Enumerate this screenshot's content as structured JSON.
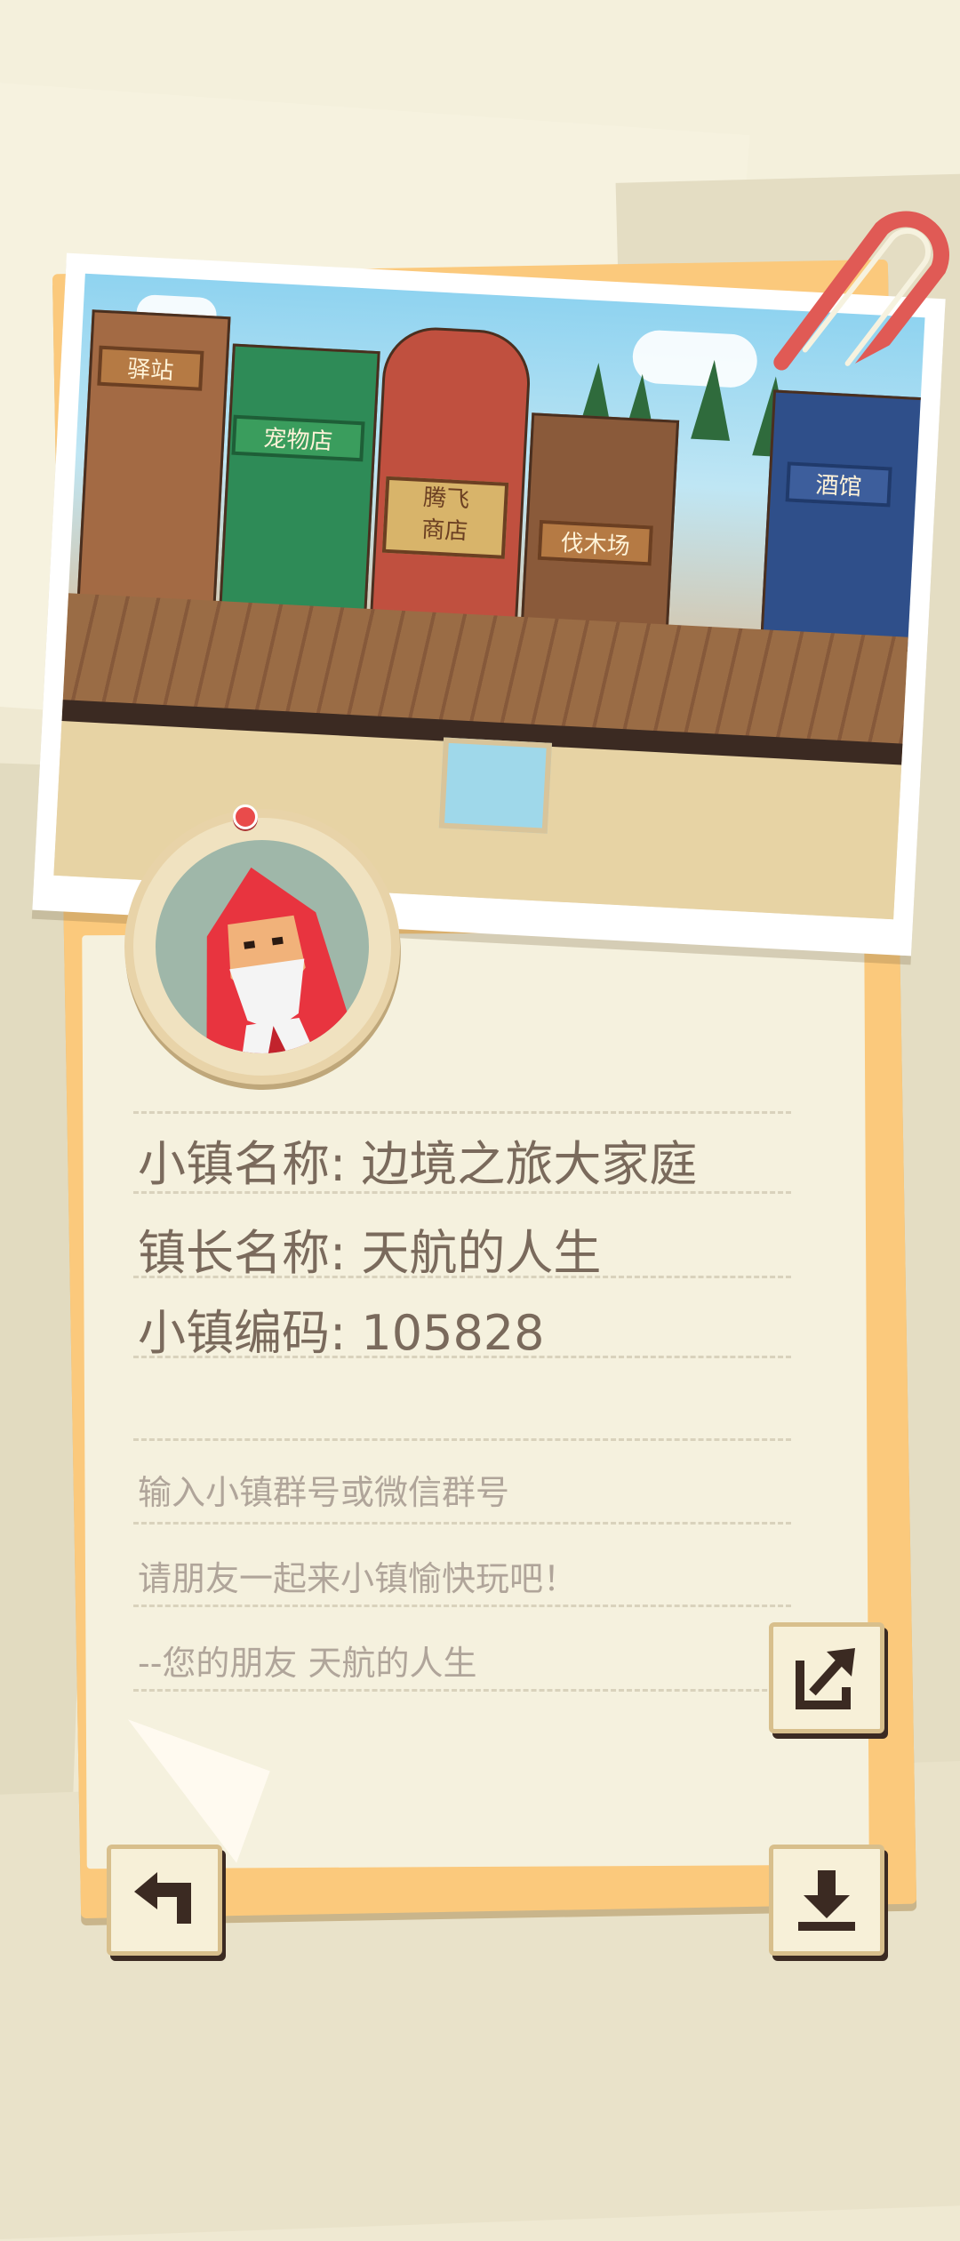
{
  "town_info": {
    "town_name_label": "小镇名称:",
    "town_name": "边境之旅大家庭",
    "mayor_name_label": "镇长名称:",
    "mayor_name": "天航的人生",
    "town_code_label": "小镇编码:",
    "town_code": "105828"
  },
  "invite": {
    "line1": "输入小镇群号或微信群号",
    "line2": "请朋友一起来小镇愉快玩吧！",
    "line3": "--您的朋友  天航的人生"
  },
  "photo_signs": {
    "station": "驿站",
    "pet_shop": "宠物店",
    "fly_shop_top": "腾飞",
    "fly_shop_bottom": "商店",
    "lumber": "伐木场",
    "bar": "酒馆"
  },
  "icons": {
    "share": "share-icon",
    "back": "back-arrow-icon",
    "download": "download-icon"
  },
  "colors": {
    "accent_orange": "#fbc97c",
    "paper": "#f5f1de",
    "text_main": "#7a6a5c",
    "text_hint": "#b0a59a",
    "clip_red": "#e05a55"
  }
}
